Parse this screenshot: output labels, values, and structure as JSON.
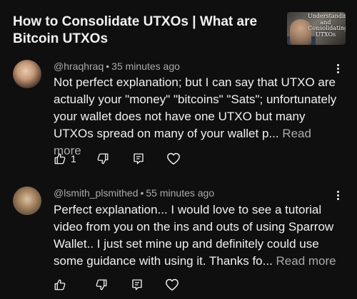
{
  "video": {
    "title": "How to Consolidate UTXOs | What are Bitcoin UTXOs",
    "thumbnail_text": "Understanding and Consolidating UTXOs",
    "thumbnail_icon": "video-thumbnail"
  },
  "comments": [
    {
      "author": "@hraqhraq",
      "separator": "•",
      "time": "35 minutes ago",
      "text": "Not perfect explanation; but I can say that UTXO are actually your \"money\"  \"bitcoins\" \"Sats\"; unfortunately your wallet does not have one UTXO but many UTXOs spread on many of your wallet p... ",
      "read_more": "Read more",
      "like_count": "1",
      "icons": [
        "thumbs-up-icon",
        "thumbs-down-icon",
        "reply-icon",
        "heart-icon",
        "more-vert-icon"
      ]
    },
    {
      "author": "@lsmith_plsmithed",
      "separator": "•",
      "time": "55 minutes ago",
      "text": "Perfect explanation... I would love to see a tutorial video from you on the ins and outs of using Sparrow Wallet.. I just set mine up and definitely could use some guidance with using it. Thanks fo... ",
      "read_more": "Read more",
      "like_count": "",
      "icons": [
        "thumbs-up-icon",
        "thumbs-down-icon",
        "reply-icon",
        "heart-icon",
        "more-vert-icon"
      ]
    }
  ],
  "colors": {
    "background": "#0f0f0f",
    "primary_text": "#f1f1f1",
    "secondary_text": "#aaaaaa"
  }
}
